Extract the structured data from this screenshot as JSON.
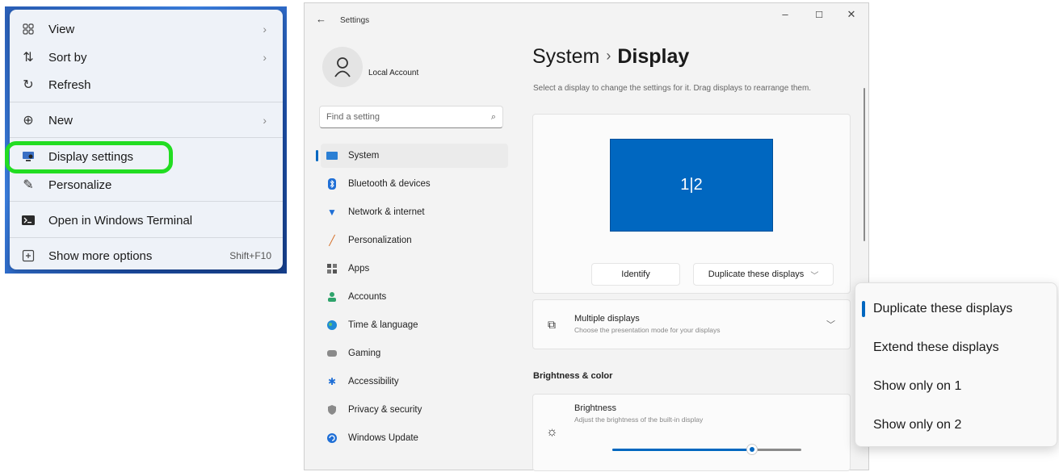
{
  "context_menu": {
    "items": [
      {
        "label": "View",
        "icon": "grid-icon",
        "submenu": true
      },
      {
        "label": "Sort by",
        "icon": "sort-icon",
        "submenu": true
      },
      {
        "label": "Refresh",
        "icon": "refresh-icon",
        "submenu": false
      },
      {
        "label": "New",
        "icon": "plus-circle-icon",
        "submenu": true
      },
      {
        "label": "Display settings",
        "icon": "display-settings-icon",
        "submenu": false
      },
      {
        "label": "Personalize",
        "icon": "brush-icon",
        "submenu": false
      },
      {
        "label": "Open in Windows Terminal",
        "icon": "terminal-icon",
        "submenu": false
      },
      {
        "label": "Show more options",
        "icon": "more-options-icon",
        "shortcut": "Shift+F10"
      }
    ],
    "highlight_color": "#22dd22"
  },
  "settings": {
    "window_title": "Settings",
    "account_name": "Local Account",
    "search_placeholder": "Find a setting",
    "nav": [
      {
        "label": "System",
        "icon": "system-icon",
        "active": true
      },
      {
        "label": "Bluetooth & devices",
        "icon": "bluetooth-icon"
      },
      {
        "label": "Network & internet",
        "icon": "wifi-icon"
      },
      {
        "label": "Personalization",
        "icon": "brush-icon"
      },
      {
        "label": "Apps",
        "icon": "apps-icon"
      },
      {
        "label": "Accounts",
        "icon": "accounts-icon"
      },
      {
        "label": "Time & language",
        "icon": "globe-icon"
      },
      {
        "label": "Gaming",
        "icon": "gamepad-icon"
      },
      {
        "label": "Accessibility",
        "icon": "accessibility-icon"
      },
      {
        "label": "Privacy & security",
        "icon": "shield-icon"
      },
      {
        "label": "Windows Update",
        "icon": "update-icon"
      }
    ],
    "breadcrumb_parent": "System",
    "breadcrumb_sep": "›",
    "breadcrumb_current": "Display",
    "description": "Select a display to change the settings for it. Drag displays to rearrange them.",
    "monitor_label": "1|2",
    "identify_label": "Identify",
    "duplicate_label": "Duplicate these displays",
    "multiple_displays": {
      "title": "Multiple displays",
      "desc": "Choose the presentation mode for your displays"
    },
    "section_brightness": "Brightness & color",
    "brightness": {
      "title": "Brightness",
      "desc": "Adjust the brightness of the built-in display",
      "level": 0.74
    },
    "accent_color": "#0067c0"
  },
  "dropdown": {
    "options": [
      {
        "label": "Duplicate these displays",
        "selected": true
      },
      {
        "label": "Extend these displays",
        "selected": false
      },
      {
        "label": "Show only on 1",
        "selected": false
      },
      {
        "label": "Show only on 2",
        "selected": false
      }
    ]
  }
}
